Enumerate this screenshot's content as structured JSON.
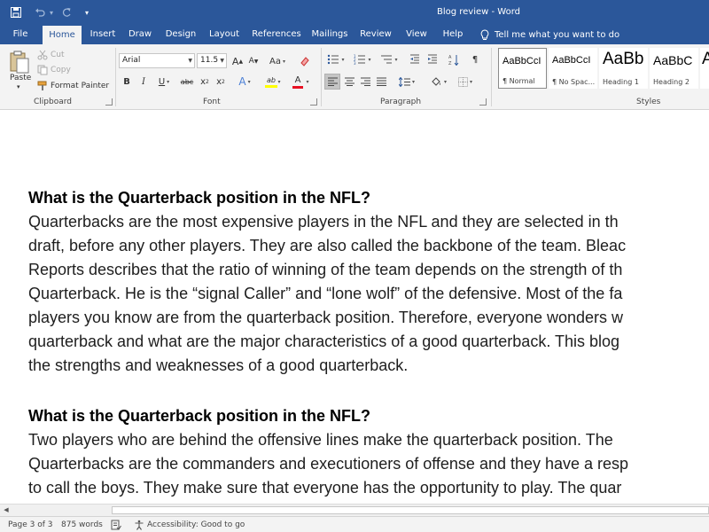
{
  "window": {
    "title": "Blog review  -  Word"
  },
  "quick_access": {
    "save_icon": "save-icon",
    "undo_icon": "undo-icon",
    "redo_icon": "redo-icon",
    "customize_icon": "customize-icon",
    "undo_caret": "▾",
    "customize_caret": "▾"
  },
  "tabs": [
    {
      "label": "File"
    },
    {
      "label": "Home"
    },
    {
      "label": "Insert"
    },
    {
      "label": "Draw"
    },
    {
      "label": "Design"
    },
    {
      "label": "Layout"
    },
    {
      "label": "References"
    },
    {
      "label": "Mailings"
    },
    {
      "label": "Review"
    },
    {
      "label": "View"
    },
    {
      "label": "Help"
    }
  ],
  "tell_me": {
    "placeholder": "Tell me what you want to do",
    "icon": "lightbulb-icon"
  },
  "ribbon": {
    "clipboard": {
      "label": "Clipboard",
      "paste": "Paste",
      "cut": "Cut",
      "copy": "Copy",
      "format_painter": "Format Painter"
    },
    "font": {
      "label": "Font",
      "font_name": "Arial",
      "font_size": "11.5",
      "grow": "A",
      "shrink": "A",
      "change_case": "Aa",
      "bold": "B",
      "italic": "I",
      "underline": "U",
      "strikethrough": "abc",
      "subscript": "x",
      "subscript_mark": "2",
      "superscript": "x",
      "superscript_mark": "2",
      "text_effects": "A",
      "highlight": "ab",
      "font_color": "A"
    },
    "paragraph": {
      "label": "Paragraph",
      "pilcrow": "¶"
    },
    "styles": {
      "label": "Styles",
      "items": [
        {
          "sample": "AaBbCcI",
          "name": "¶ Normal"
        },
        {
          "sample": "AaBbCcI",
          "name": "¶ No Spac..."
        },
        {
          "sample": "AaBb",
          "name": "Heading 1"
        },
        {
          "sample": "AaBbC",
          "name": "Heading 2"
        },
        {
          "sample": "A",
          "name": ""
        }
      ]
    }
  },
  "colors": {
    "brand_blue": "#2b579a",
    "highlight_yellow": "#ffff00",
    "font_red": "#e81123"
  },
  "document": {
    "lines": [
      {
        "text": "What is the Quarterback position in the NFL?",
        "heading": true
      },
      {
        "text": " Quarterbacks are the most expensive players in the NFL and they are selected in th",
        "heading": false
      },
      {
        "text": "draft, before any other players. They are also called the backbone of the team. Bleac",
        "heading": false
      },
      {
        "text": "Reports describes that the ratio of winning of the team depends on the strength of th",
        "heading": false
      },
      {
        "text": "Quarterback. He is the “signal Caller” and “lone wolf” of the defensive. Most of the fa",
        "heading": false
      },
      {
        "text": "players you know are from the quarterback position. Therefore, everyone wonders w",
        "heading": false
      },
      {
        "text": "quarterback and what are the major characteristics of a good quarterback. This blog",
        "heading": false
      },
      {
        "text": "the strengths and weaknesses of a good quarterback.",
        "heading": false
      },
      {
        "text": "What is the Quarterback position in the NFL?",
        "heading": true
      },
      {
        "text": "Two players who are behind the offensive lines make the quarterback position. The",
        "heading": false
      },
      {
        "text": "Quarterbacks are the commanders and executioners of offense and they have a resp",
        "heading": false
      },
      {
        "text": "to call the boys. They make sure that everyone has the opportunity to play. The quar",
        "heading": false
      }
    ]
  },
  "status_bar": {
    "page": "Page 3 of 3",
    "words": "875 words",
    "proofing_icon": "proofing-icon",
    "accessibility": "Accessibility: Good to go"
  }
}
